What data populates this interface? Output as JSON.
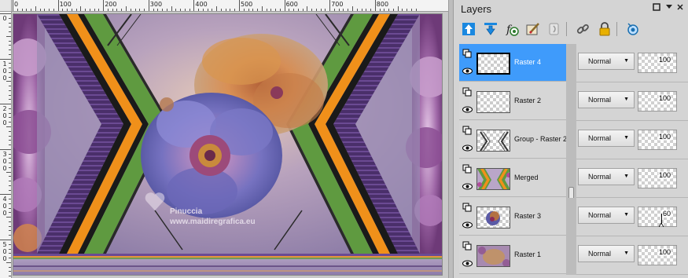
{
  "rulers": {
    "horizontal": [
      "0",
      "100",
      "200",
      "300",
      "400",
      "500",
      "600",
      "700",
      "800"
    ],
    "vertical": [
      "0",
      "100",
      "200",
      "300",
      "400",
      "500"
    ]
  },
  "artwork": {
    "watermark_line1": "Pinuccia",
    "watermark_line2": "www.maidiregrafica.eu"
  },
  "panel": {
    "title": "Layers",
    "header_buttons": [
      "maximize-icon",
      "menu-arrow-icon",
      "close-icon"
    ]
  },
  "toolbar": {
    "tools": [
      {
        "name": "move-layer-up-icon",
        "color": "#1a88e0"
      },
      {
        "name": "move-layer-down-icon",
        "color": "#1a88e0"
      },
      {
        "name": "new-mask-layer-icon",
        "color": "#2d7a2d"
      },
      {
        "name": "edit-layer-icon",
        "color": "#8a6a2a"
      },
      {
        "name": "merge-layers-icon",
        "color": "#9a9a9a"
      },
      {
        "name": "link-layers-icon",
        "color": "#555555"
      },
      {
        "name": "lock-transparency-icon",
        "color": "#d8a000"
      },
      {
        "name": "layer-visibility-settings-icon",
        "color": "#1a6fb0"
      }
    ]
  },
  "layers": [
    {
      "name": "Raster 4",
      "blend": "Normal",
      "opacity": "100",
      "selected": true
    },
    {
      "name": "Raster 2",
      "blend": "Normal",
      "opacity": "100",
      "selected": false
    },
    {
      "name": "Group - Raster 2",
      "blend": "Normal",
      "opacity": "100",
      "selected": false
    },
    {
      "name": "Merged",
      "blend": "Normal",
      "opacity": "100",
      "selected": false
    },
    {
      "name": "Raster 3",
      "blend": "Normal",
      "opacity": "60",
      "selected": false
    },
    {
      "name": "Raster 1",
      "blend": "Normal",
      "opacity": "100",
      "selected": false
    }
  ],
  "colors": {
    "selection": "#3f9bfb",
    "stripe_orange": "#f0901a",
    "stripe_green": "#5f9a40",
    "stripe_purple": "#4a2f6a",
    "background_lavender": "#9b8db3"
  }
}
